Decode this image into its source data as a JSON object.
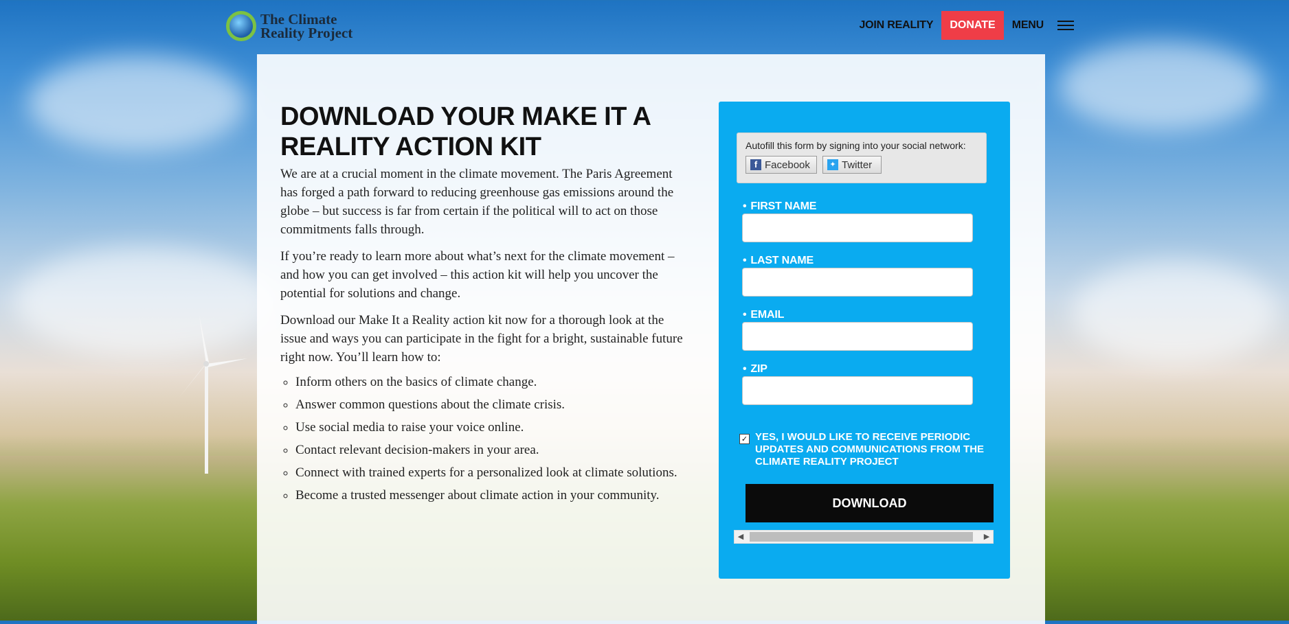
{
  "header": {
    "logo_line1": "The Climate",
    "logo_line2": "Reality Project",
    "nav": {
      "join_label": "JOIN REALITY",
      "donate_label": "DONATE",
      "menu_label": "MENU"
    }
  },
  "main": {
    "headline": "DOWNLOAD YOUR MAKE IT A REALITY ACTION KIT",
    "paragraphs": [
      "We are at a crucial moment in the climate movement. The Paris Agreement has forged a path forward to reducing greenhouse gas emissions around the globe – but success is far from certain if the political will to act on those commitments falls through.",
      "If you’re ready to learn more about what’s next for the climate movement – and how you can get involved – this action kit will help you uncover the potential for solutions and change.",
      "Download our Make It a Reality action kit now for a thorough look at the issue and ways you can participate in the fight for a bright, sustainable future right now. You’ll learn how to:"
    ],
    "list": [
      "Inform others on the basics of climate change.",
      "Answer common questions about the climate crisis.",
      "Use social media to raise your voice online.",
      "Contact relevant decision-makers in your area.",
      "Connect with trained experts for a personalized look at climate solutions.",
      "Become a trusted messenger about climate action in your community."
    ]
  },
  "form": {
    "social_caption": "Autofill this form by signing into your social network:",
    "facebook_label": "Facebook",
    "twitter_label": "Twitter",
    "required_marker": "•",
    "fields": [
      {
        "label": "FIRST NAME",
        "value": ""
      },
      {
        "label": "LAST NAME",
        "value": ""
      },
      {
        "label": "EMAIL",
        "value": ""
      },
      {
        "label": "ZIP",
        "value": ""
      }
    ],
    "optin_checked": true,
    "optin_text": "YES, I WOULD LIKE TO RECEIVE PERIODIC UPDATES AND COMMUNICATIONS FROM THE CLIMATE REALITY PROJECT",
    "submit_label": "DOWNLOAD"
  },
  "colors": {
    "donate": "#ef3d47",
    "form_bg": "#0aabf0",
    "button": "#0b0b0b"
  }
}
